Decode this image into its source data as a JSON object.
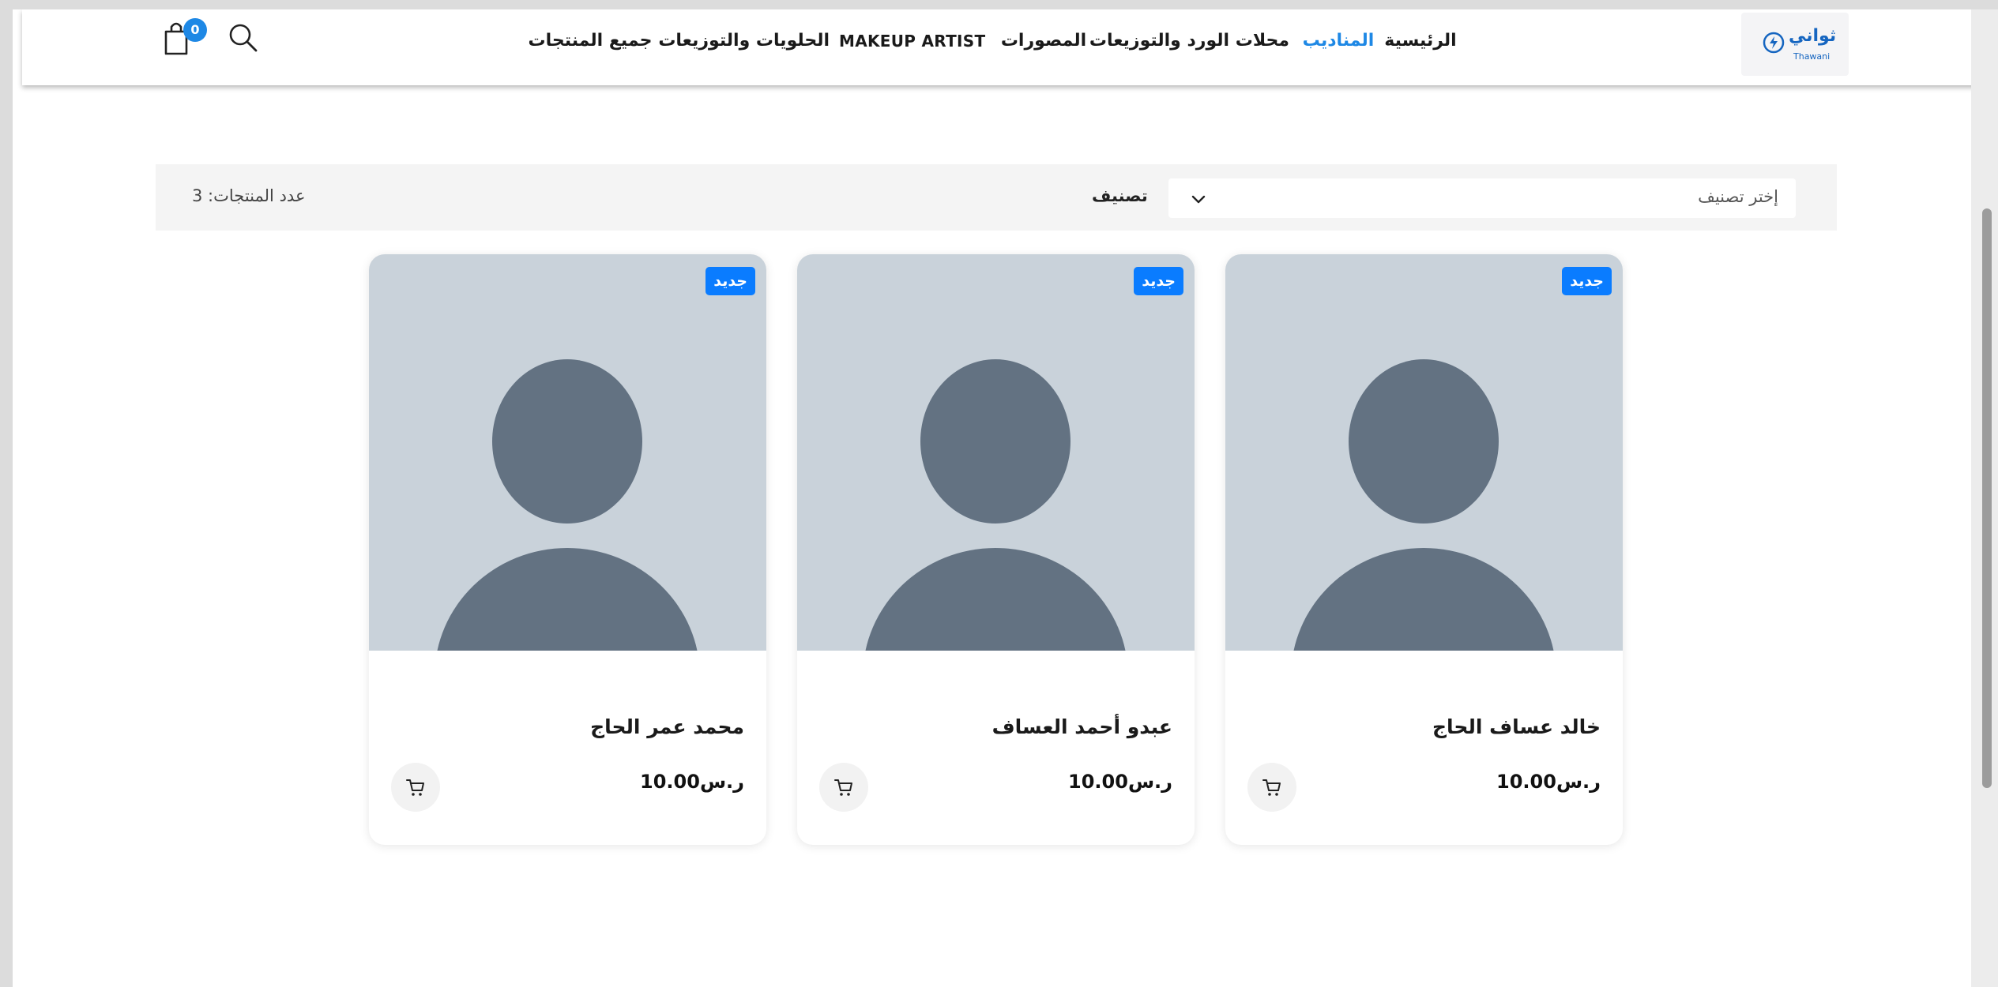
{
  "header": {
    "logo": {
      "text_ar": "ثواني",
      "text_en": "Thawani"
    },
    "nav": [
      {
        "label": "الرئيسية"
      },
      {
        "label": "المناديب"
      },
      {
        "label": "محلات الورد والتوزيعات"
      },
      {
        "label": "المصورات"
      },
      {
        "label": "MAKEUP ARTIST"
      },
      {
        "label": "الحلويات والتوزيعات"
      },
      {
        "label": "جميع المنتجات"
      }
    ],
    "active_nav": "المناديب",
    "cart_count": "0",
    "icons": {
      "search": "search-icon",
      "cart": "shopping-bag-icon"
    }
  },
  "filter": {
    "label": "تصنيف",
    "select_placeholder": "إختر تصنيف",
    "product_count": "عدد المنتجات: 3"
  },
  "products": [
    {
      "name": "خالد عساف الحاج",
      "price": "10.00ر.س",
      "badge": "جديد"
    },
    {
      "name": "عبدو أحمد العساف",
      "price": "10.00ر.س",
      "badge": "جديد"
    },
    {
      "name": "محمد عمر الحاج",
      "price": "10.00ر.س",
      "badge": "جديد"
    }
  ],
  "colors": {
    "accent": "#1e88e5",
    "badge": "#0a7cff",
    "avatar_bg": "#c9d2da",
    "avatar_fg": "#637282"
  }
}
